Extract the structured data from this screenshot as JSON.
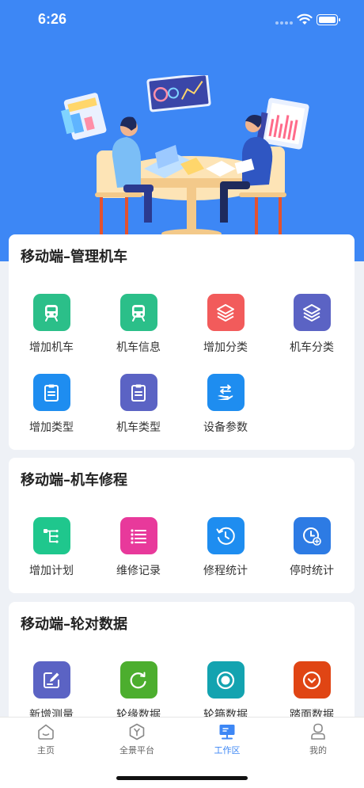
{
  "status_bar": {
    "time": "6:26"
  },
  "sections": [
    {
      "title": "移动端–管理机车",
      "items": [
        {
          "label": "增加机车",
          "icon": "train-icon",
          "color": "#2bbf89"
        },
        {
          "label": "机车信息",
          "icon": "train-icon",
          "color": "#2bbf89"
        },
        {
          "label": "增加分类",
          "icon": "layers-icon",
          "color": "#f25b5b"
        },
        {
          "label": "机车分类",
          "icon": "layers-icon",
          "color": "#5b63c4"
        },
        {
          "label": "增加类型",
          "icon": "clipboard-icon",
          "color": "#1e8df0"
        },
        {
          "label": "机车类型",
          "icon": "clipboard-icon",
          "color": "#5b63c4"
        },
        {
          "label": "设备参数",
          "icon": "hand-transfer-icon",
          "color": "#1e8df0"
        }
      ]
    },
    {
      "title": "移动端–机车修程",
      "items": [
        {
          "label": "增加计划",
          "icon": "tree-icon",
          "color": "#1fc78d"
        },
        {
          "label": "维修记录",
          "icon": "list-icon",
          "color": "#e8399b"
        },
        {
          "label": "修程统计",
          "icon": "history-clock-icon",
          "color": "#1e8df0"
        },
        {
          "label": "停时统计",
          "icon": "clock-plus-icon",
          "color": "#2d7be4"
        }
      ]
    },
    {
      "title": "移动端–轮对数据",
      "items": [
        {
          "label": "新增测量",
          "icon": "edit-icon",
          "color": "#5b63c4"
        },
        {
          "label": "轮缘数据",
          "icon": "circle-refresh-icon",
          "color": "#4cae2e"
        },
        {
          "label": "轮箍数据",
          "icon": "record-icon",
          "color": "#13a3b0"
        },
        {
          "label": "踏面数据",
          "icon": "chevron-circle-icon",
          "color": "#e04514"
        }
      ]
    }
  ],
  "tabbar": {
    "tabs": [
      {
        "label": "主页",
        "icon": "home-icon"
      },
      {
        "label": "全景平台",
        "icon": "panorama-icon"
      },
      {
        "label": "工作区",
        "icon": "workspace-icon",
        "active": true
      },
      {
        "label": "我的",
        "icon": "profile-icon"
      }
    ],
    "active_color": "#3d87f5"
  }
}
